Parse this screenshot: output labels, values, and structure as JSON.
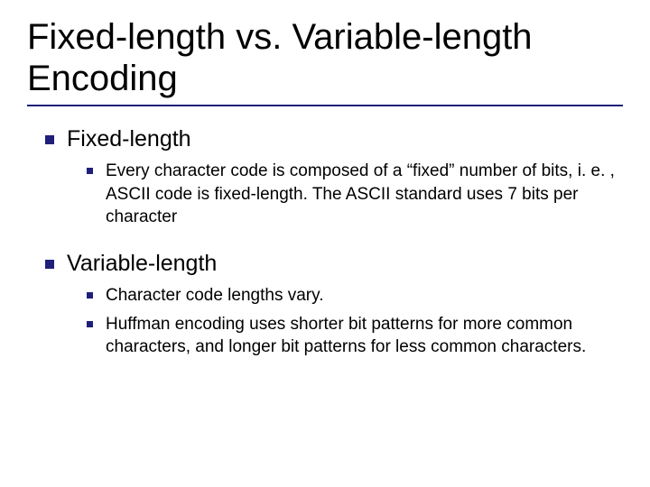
{
  "title": "Fixed-length vs. Variable-length Encoding",
  "sections": [
    {
      "heading": "Fixed-length",
      "items": [
        "Every character code is composed of a “fixed” number of bits, i. e. , ASCII code is fixed-length. The ASCII standard uses 7 bits per character"
      ]
    },
    {
      "heading": "Variable-length",
      "items": [
        "Character code lengths vary.",
        "Huffman encoding uses shorter bit patterns for more common characters, and longer bit patterns for less common characters."
      ]
    }
  ]
}
